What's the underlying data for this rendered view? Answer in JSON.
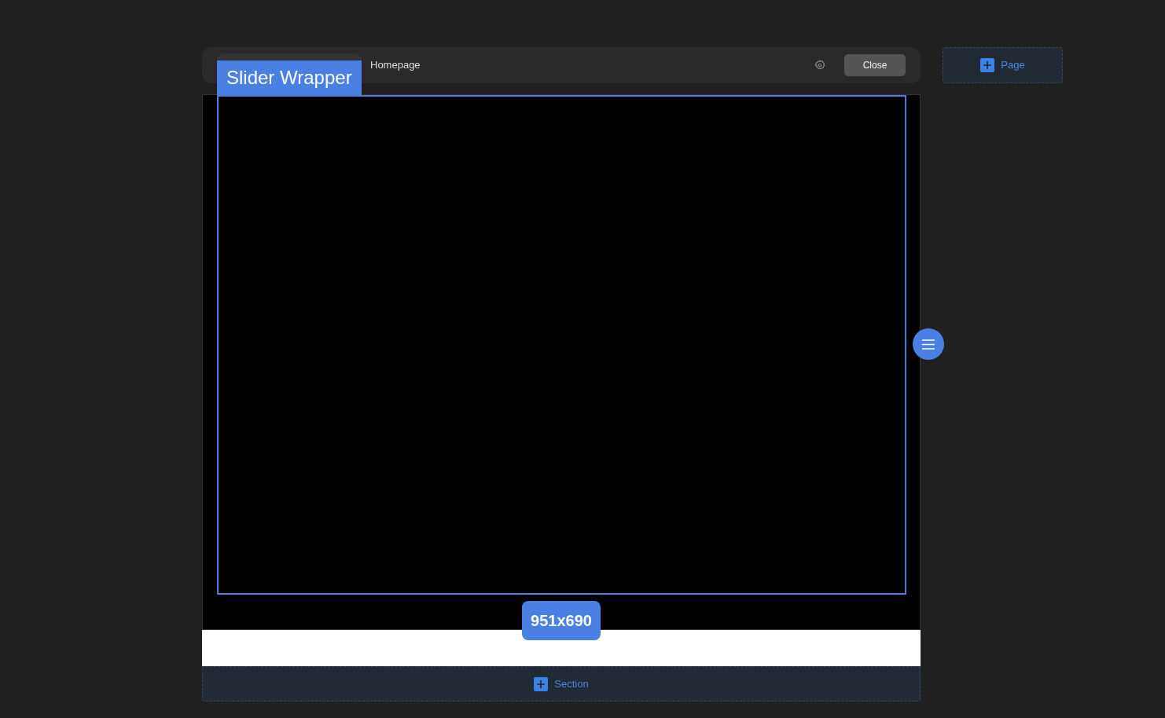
{
  "toolbar": {
    "breadcrumb": "Homepage",
    "close_button": "Close"
  },
  "selection": {
    "label": "Slider Wrapper",
    "size": "951x690"
  },
  "add_page_button": "Page",
  "add_section_button": "Section"
}
